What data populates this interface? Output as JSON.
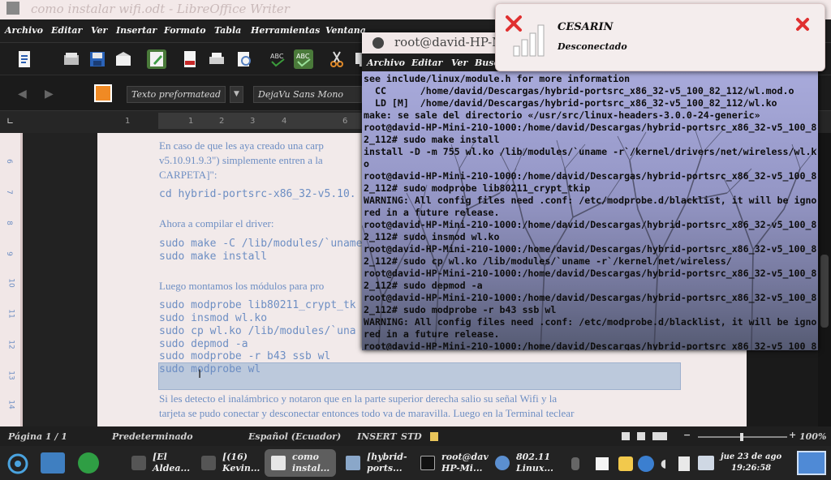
{
  "writer": {
    "title": "como instalar wifi.odt - LibreOffice Writer",
    "menu": [
      "Archivo",
      "Editar",
      "Ver",
      "Insertar",
      "Formato",
      "Tabla",
      "Herramientas",
      "Ventana"
    ],
    "style_combo": "Texto preformatead",
    "font_combo": "DejaVu Sans Mono",
    "ruler_numbers": [
      "1",
      "1",
      "2",
      "3",
      "4",
      "6"
    ],
    "left_ruler_numbers": [
      "6",
      "7",
      "8",
      "9",
      "10",
      "11",
      "12",
      "13",
      "14"
    ],
    "page_lines": {
      "l1": "En caso de que les aya creado una carp",
      "l2": "v5.10.91.9.3\") simplemente entren a la",
      "l3": "CARPETA]\":",
      "l4": "cd hybrid-portsrc-x86_32-v5.10.",
      "l5": "Ahora a compilar el driver:",
      "l6": "sudo make -C /lib/modules/`uname",
      "l7": "sudo make install",
      "l8": "Luego montamos los módulos para pro",
      "l9": "sudo modprobe lib80211_crypt_tk",
      "l10": "sudo insmod wl.ko",
      "l11": "sudo cp wl.ko /lib/modules/`una",
      "l12": "sudo depmod -a",
      "l13": "sudo modprobe -r b43 ssb wl",
      "l14": "sudo modprobe wl",
      "l15": "Si les detecto el inalámbrico y notaron que en la parte superior derecha salio su señal Wifi y la",
      "l16": "tarjeta se pudo conectar y desconectar entonces todo va de maravilla. Luego en la Terminal teclear"
    },
    "status": {
      "page": "Página  1 / 1",
      "style": "Predeterminado",
      "language": "Español (Ecuador)",
      "insert": "INSERT",
      "std": "STD",
      "zoom": "100%"
    }
  },
  "terminal": {
    "title": "root@david-HP-M",
    "menu": [
      "Archivo",
      "Editar",
      "Ver",
      "Busc"
    ],
    "lines": [
      "see include/linux/module.h for more information",
      "  CC      /home/david/Descargas/hybrid-portsrc_x86_32-v5_100_82_112/wl.mod.o",
      "  LD [M]  /home/david/Descargas/hybrid-portsrc_x86_32-v5_100_82_112/wl.ko",
      "make: se sale del directorio «/usr/src/linux-headers-3.0.0-24-generic»",
      "root@david-HP-Mini-210-1000:/home/david/Descargas/hybrid-portsrc_x86_32-v5_100_8",
      "2_112# sudo make install",
      "install -D -m 755 wl.ko /lib/modules/`uname -r`/kernel/drivers/net/wireless/wl.k",
      "o",
      "root@david-HP-Mini-210-1000:/home/david/Descargas/hybrid-portsrc_x86_32-v5_100_8",
      "2_112# sudo modprobe lib80211_crypt_tkip",
      "WARNING: All config files need .conf: /etc/modprobe.d/blacklist, it will be igno",
      "red in a future release.",
      "root@david-HP-Mini-210-1000:/home/david/Descargas/hybrid-portsrc_x86_32-v5_100_8",
      "2_112# sudo insmod wl.ko",
      "root@david-HP-Mini-210-1000:/home/david/Descargas/hybrid-portsrc_x86_32-v5_100_8",
      "2_112# sudo cp wl.ko /lib/modules/`uname -r`/kernel/net/wireless/",
      "root@david-HP-Mini-210-1000:/home/david/Descargas/hybrid-portsrc_x86_32-v5_100_8",
      "2_112# sudo depmod -a",
      "root@david-HP-Mini-210-1000:/home/david/Descargas/hybrid-portsrc_x86_32-v5_100_8",
      "2_112# sudo modprobe -r b43 ssb wl",
      "WARNING: All config files need .conf: /etc/modprobe.d/blacklist, it will be igno",
      "red in a future release.",
      "root@david-HP-Mini-210-1000:/home/david/Descargas/hybrid-portsrc_x86_32-v5_100_8"
    ]
  },
  "notification": {
    "title": "CESARIN",
    "body": "Desconectado",
    "icon": "wifi-disconnected-icon",
    "close_icon": "close-icon"
  },
  "taskbar": {
    "tasks": [
      {
        "line1": "[El",
        "line2": "Aldea..."
      },
      {
        "line1": "[(16)",
        "line2": "Kevin..."
      },
      {
        "line1": "como",
        "line2": "instal..."
      },
      {
        "line1": "[hybrid-",
        "line2": "ports..."
      },
      {
        "line1": "root@dav",
        "line2": "HP-Mi..."
      },
      {
        "line1": "802.11",
        "line2": "Linux..."
      }
    ],
    "clock_date": "jue 23 de ago",
    "clock_time": "19:26:58"
  },
  "colors": {
    "accent_blue": "#6d8ec3",
    "close_red": "#e03030",
    "terminal_bg": "#9496c5"
  }
}
